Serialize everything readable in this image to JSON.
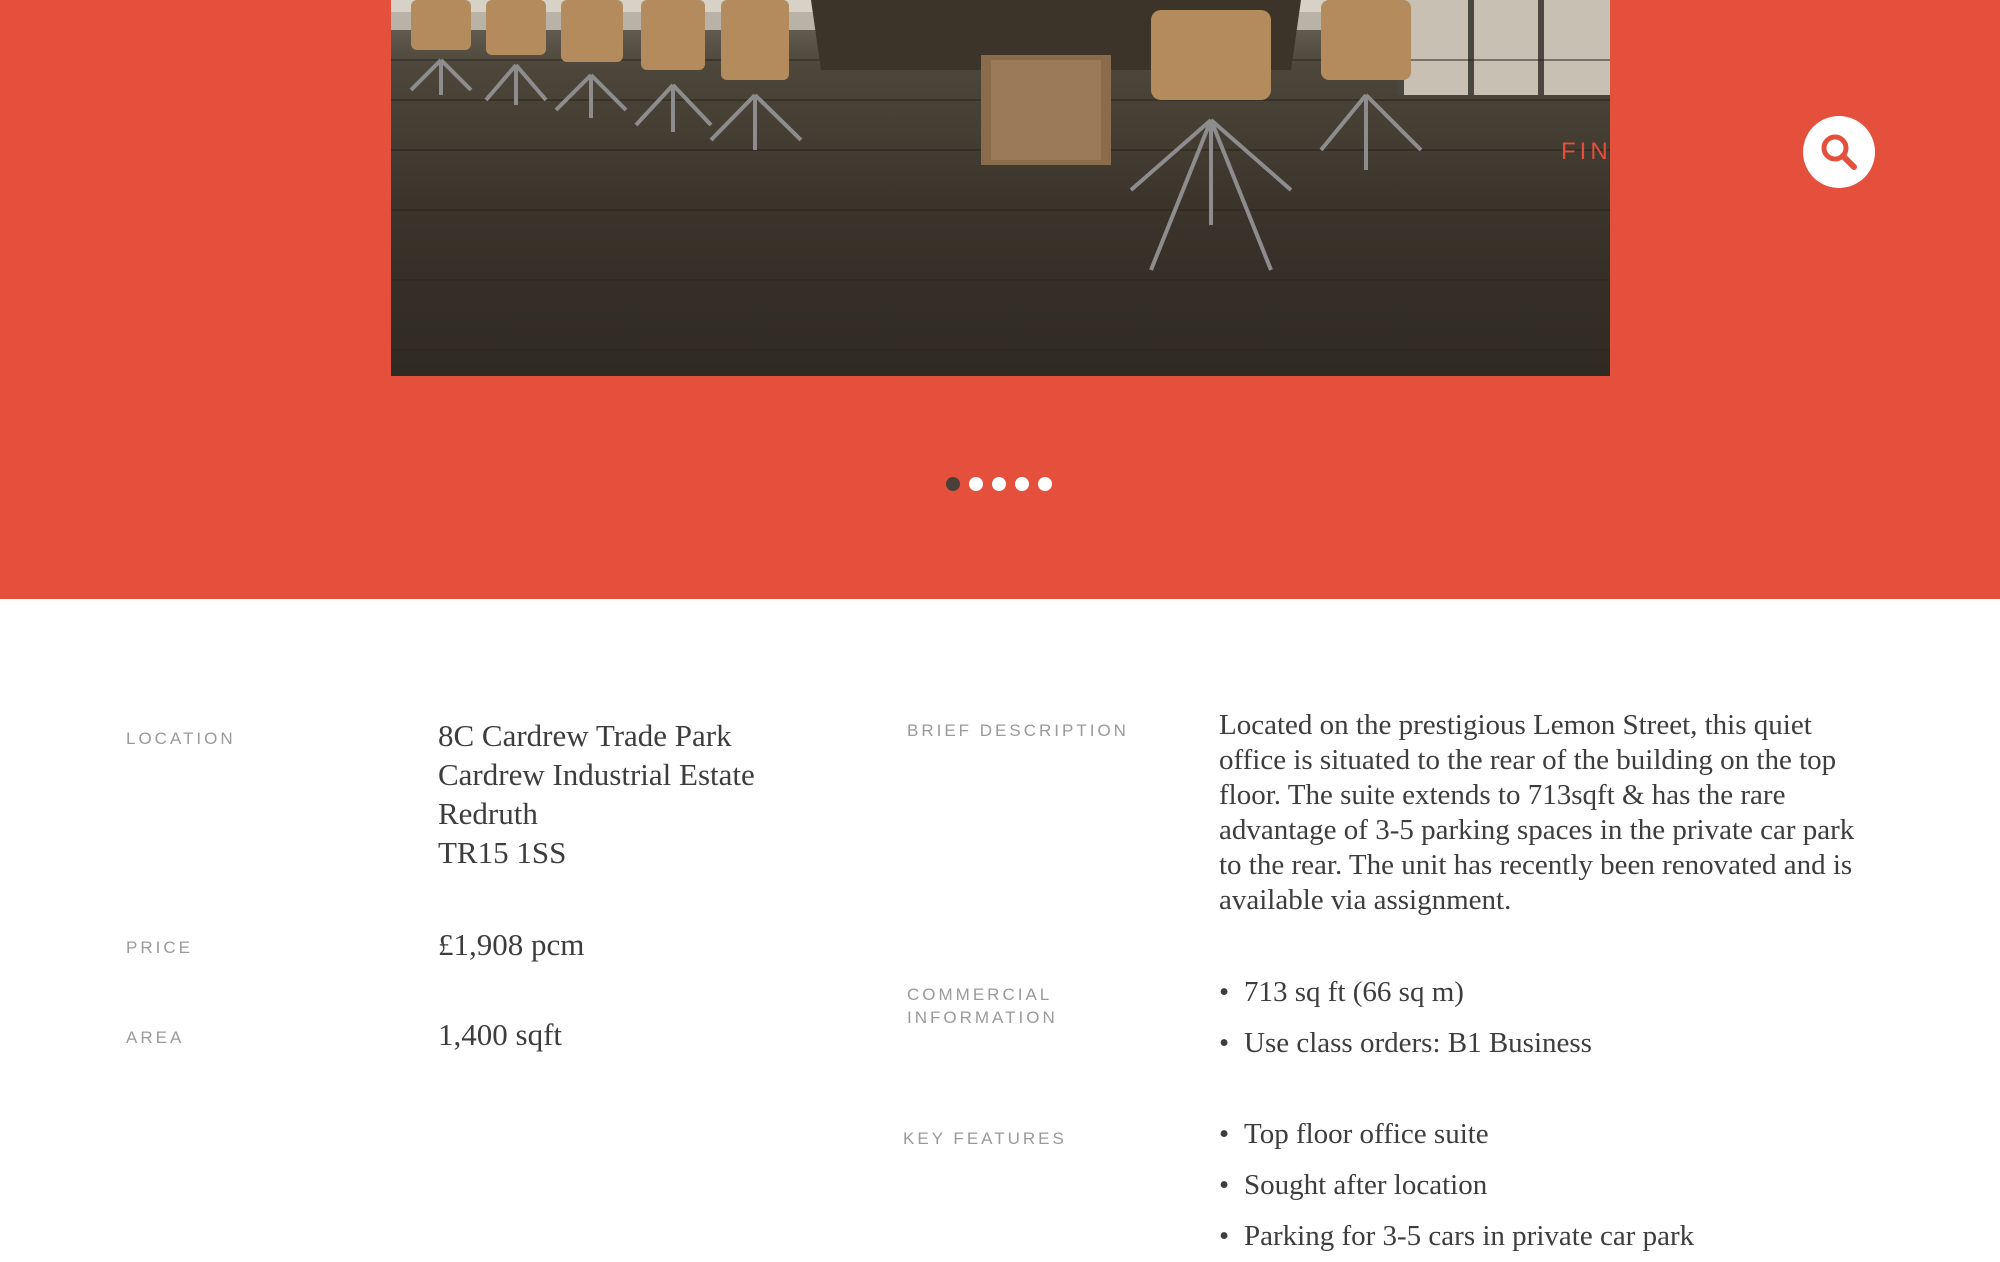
{
  "hero": {
    "find_label": "FIND",
    "search_icon": "search-icon",
    "slider_dots": [
      {
        "active": true
      },
      {
        "active": false
      },
      {
        "active": false
      },
      {
        "active": false
      },
      {
        "active": false
      }
    ],
    "photo": "conference-room-photo"
  },
  "details": {
    "location_label": "LOCATION",
    "location_lines": [
      "8C Cardrew Trade Park",
      "Cardrew Industrial Estate",
      "Redruth",
      "TR15 1SS"
    ],
    "price_label": "PRICE",
    "price_value": "£1,908 pcm",
    "area_label": "AREA",
    "area_value": "1,400 sqft",
    "brief_label": "BRIEF DESCRIPTION",
    "brief_text": "Located on the prestigious Lemon Street, this quiet office is situated to the rear of the building on the top floor. The suite extends to 713sqft & has the rare advantage of 3-5 parking spaces in the private car park to the rear. The unit has recently been renovated and is available via assignment.",
    "commercial_label_1": "COMMERCIAL",
    "commercial_label_2": "INFORMATION",
    "commercial_items": [
      "713 sq ft (66 sq m)",
      "Use class orders: B1 Business"
    ],
    "features_label": "KEY FEATURES",
    "features_items": [
      "Top floor office suite",
      "Sought after location",
      "Parking for 3-5 cars in private car park"
    ]
  },
  "colors": {
    "accent": "#e4503c",
    "text": "#3d3d3d",
    "label": "#9a9a9a"
  }
}
